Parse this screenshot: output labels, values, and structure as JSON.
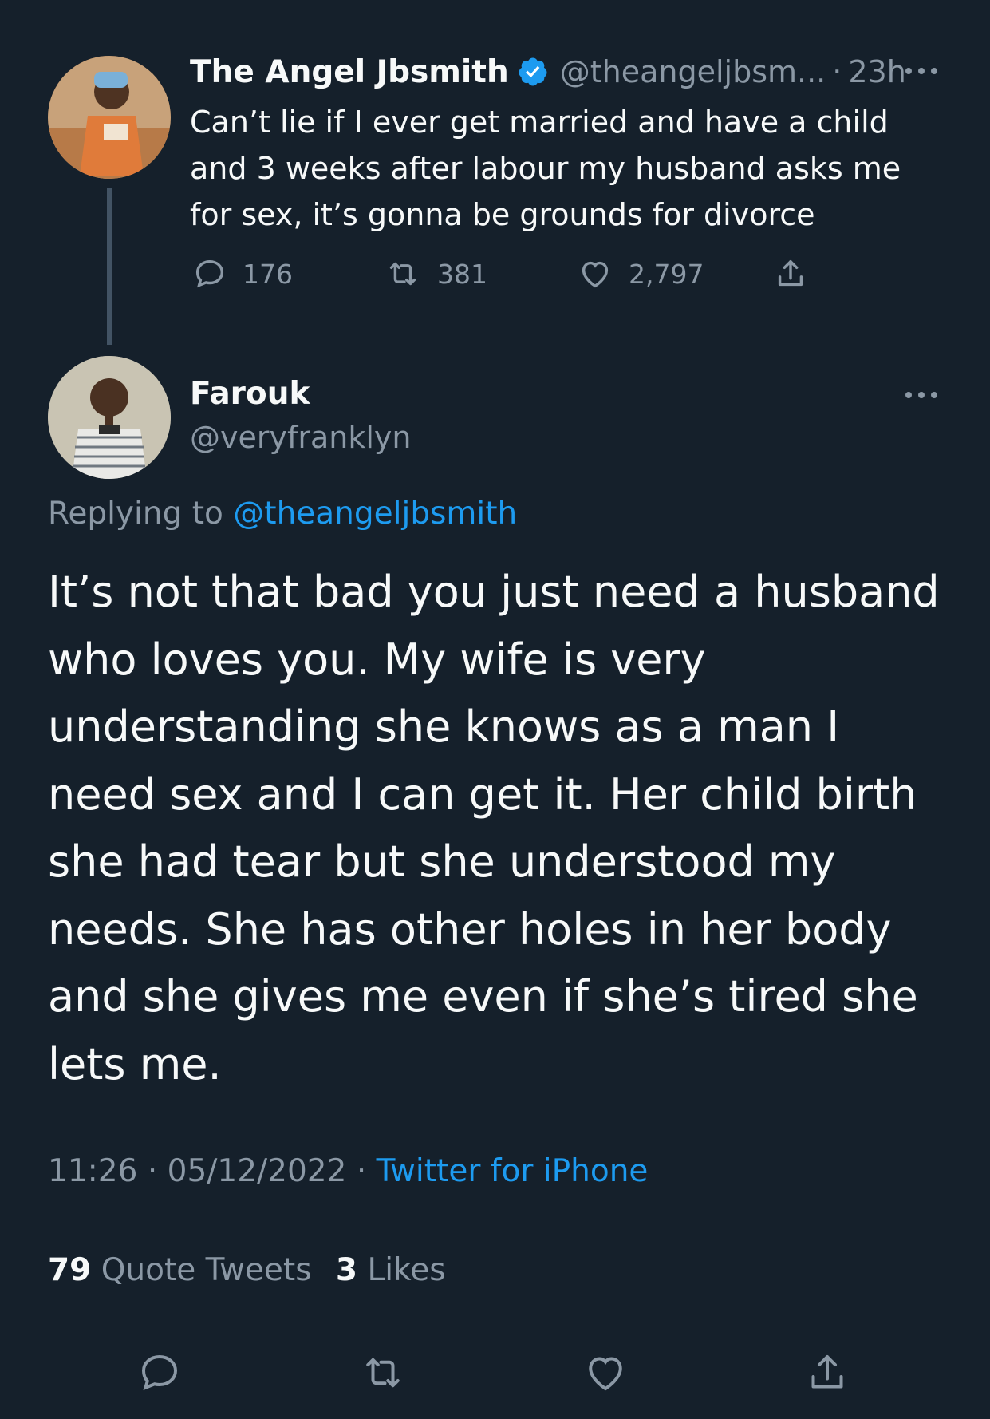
{
  "parent_tweet": {
    "name": "The Angel Jbsmith",
    "handle": "@theangeljbsm...",
    "separator": "·",
    "time": "23h",
    "text": "Can’t lie if I ever get married and have a child and 3 weeks after labour my husband asks me for sex, it’s gonna be grounds for divorce",
    "replies": "176",
    "retweets": "381",
    "likes": "2,797",
    "verified_icon": "verified-badge-icon",
    "colors": {
      "verified": "#1d9bf0"
    }
  },
  "main_tweet": {
    "name": "Farouk",
    "handle": "@veryfranklyn",
    "replying_prefix": "Replying to",
    "replying_handle": "@theangeljbsmith",
    "text": "It’s not that bad you just need a husband who loves you. My wife is very understanding she knows as a man I need sex and I can get it. Her child birth she had tear but she understood my needs. She has other holes in her body and she gives me even if she’s tired she lets me.",
    "time": "11:26",
    "dot1": "·",
    "date": "05/12/2022",
    "dot2": "·",
    "source": "Twitter for iPhone",
    "quote_count": "79",
    "quote_label": "Quote Tweets",
    "like_count": "3",
    "like_label": "Likes"
  },
  "colors": {
    "background": "#15202b",
    "text": "#f7f9f9",
    "muted": "#8b98a5",
    "accent": "#1d9bf0",
    "divider": "#38444d"
  }
}
